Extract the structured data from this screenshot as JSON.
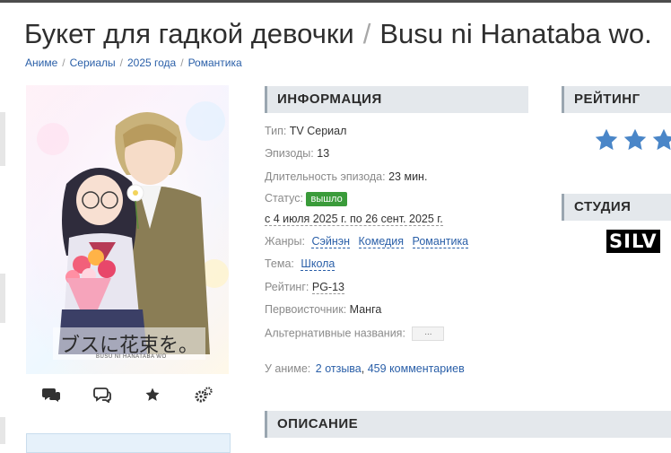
{
  "title": {
    "ru": "Букет для гадкой девочки",
    "sep": "/",
    "jp": "Busu ni Hanataba wo."
  },
  "breadcrumbs": [
    "Аниме",
    "Сериалы",
    "2025 года",
    "Романтика"
  ],
  "poster": {
    "logo_text": "ブスに花束を。",
    "logo_sub": "BUSU NI HANATABA WO"
  },
  "actions": [
    {
      "icon": "comments-icon"
    },
    {
      "icon": "chat-icon"
    },
    {
      "icon": "star-icon"
    },
    {
      "icon": "settings-icon"
    }
  ],
  "info": {
    "header": "ИНФОРМАЦИЯ",
    "type_label": "Тип:",
    "type_value": "TV Сериал",
    "episodes_label": "Эпизоды:",
    "episodes_value": "13",
    "duration_label": "Длительность эпизода:",
    "duration_value": "23 мин.",
    "status_label": "Статус:",
    "status_value": "вышло",
    "dates": "с 4 июля 2025 г. по 26 сент. 2025 г.",
    "genres_label": "Жанры:",
    "genres": [
      "Сэйнэн",
      "Комедия",
      "Романтика"
    ],
    "theme_label": "Тема:",
    "theme_value": "Школа",
    "rating_label": "Рейтинг:",
    "rating_value": "PG-13",
    "source_label": "Первоисточник:",
    "source_value": "Манга",
    "alt_label": "Альтернативные названия:",
    "alt_button": "...",
    "anime_label": "У аниме:",
    "reviews": "2 отзыва",
    "comma": ",",
    "comments": "459 комментариев"
  },
  "rating_block": {
    "header": "РЕЙТИНГ",
    "star_color": "#4a86c8"
  },
  "studio_block": {
    "header": "СТУДИЯ",
    "logo_text": "SILV"
  },
  "description": {
    "header": "ОПИСАНИЕ"
  },
  "colors": {
    "link": "#2a5fa8",
    "status_green": "#3a9b3a",
    "section_bg": "#e4e8ec"
  }
}
